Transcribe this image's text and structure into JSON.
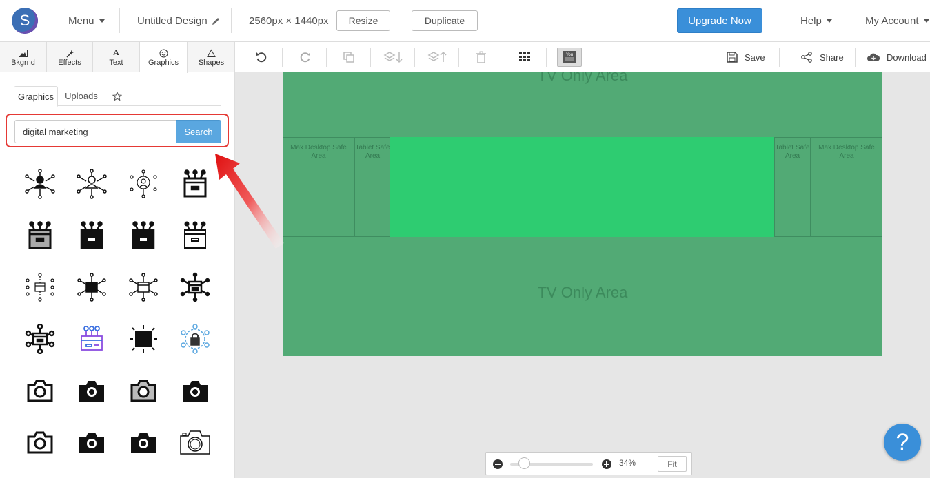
{
  "header": {
    "logo_letter": "S",
    "menu_label": "Menu",
    "design_title": "Untitled Design",
    "dimensions": "2560px × 1440px",
    "resize_label": "Resize",
    "duplicate_label": "Duplicate",
    "upgrade_label": "Upgrade Now",
    "help_label": "Help",
    "account_label": "My Account"
  },
  "left_tabs": [
    {
      "label": "Bkgrnd",
      "icon": "image-icon"
    },
    {
      "label": "Effects",
      "icon": "magic-wand-icon"
    },
    {
      "label": "Text",
      "icon": "text-icon"
    },
    {
      "label": "Graphics",
      "icon": "smiley-icon",
      "active": true
    },
    {
      "label": "Shapes",
      "icon": "triangle-icon"
    }
  ],
  "sub_tabs": {
    "graphics": "Graphics",
    "uploads": "Uploads"
  },
  "search": {
    "value": "digital marketing",
    "button_label": "Search"
  },
  "graphics_results": [
    "network-person-icon",
    "network-person-outline-icon",
    "network-avatar-icon",
    "box-antenna-icon",
    "box-antenna-gray-icon",
    "box-antenna-filled-icon",
    "box-antenna-filled-icon",
    "box-antenna-outline-icon",
    "network-box-dots-icon",
    "network-box-filled-icon",
    "network-box-outline-icon",
    "network-box-bold-icon",
    "network-box-circles-icon",
    "box-purple-antenna-icon",
    "box-sun-icon",
    "lock-network-icon",
    "camera-outline-icon",
    "camera-filled-icon",
    "camera-gray-icon",
    "camera-filled-icon",
    "camera-outline-icon",
    "camera-filled-icon",
    "camera-filled-icon",
    "camera-thin-icon"
  ],
  "toolbar": {
    "save_label": "Save",
    "share_label": "Share",
    "download_label": "Download"
  },
  "canvas": {
    "top_label": "TV Only Area",
    "bottom_label": "TV Only Area",
    "max_desktop_left": "Max Desktop Safe Area",
    "tablet_left": "Tablet Safe Area",
    "tablet_right": "Tablet Safe Area",
    "max_desktop_right": "Max Desktop Safe Area",
    "bg_color": "#52aa75",
    "safe_color": "#2ecc71"
  },
  "zoom": {
    "level": "34%",
    "fit_label": "Fit"
  },
  "help_fab": "?"
}
